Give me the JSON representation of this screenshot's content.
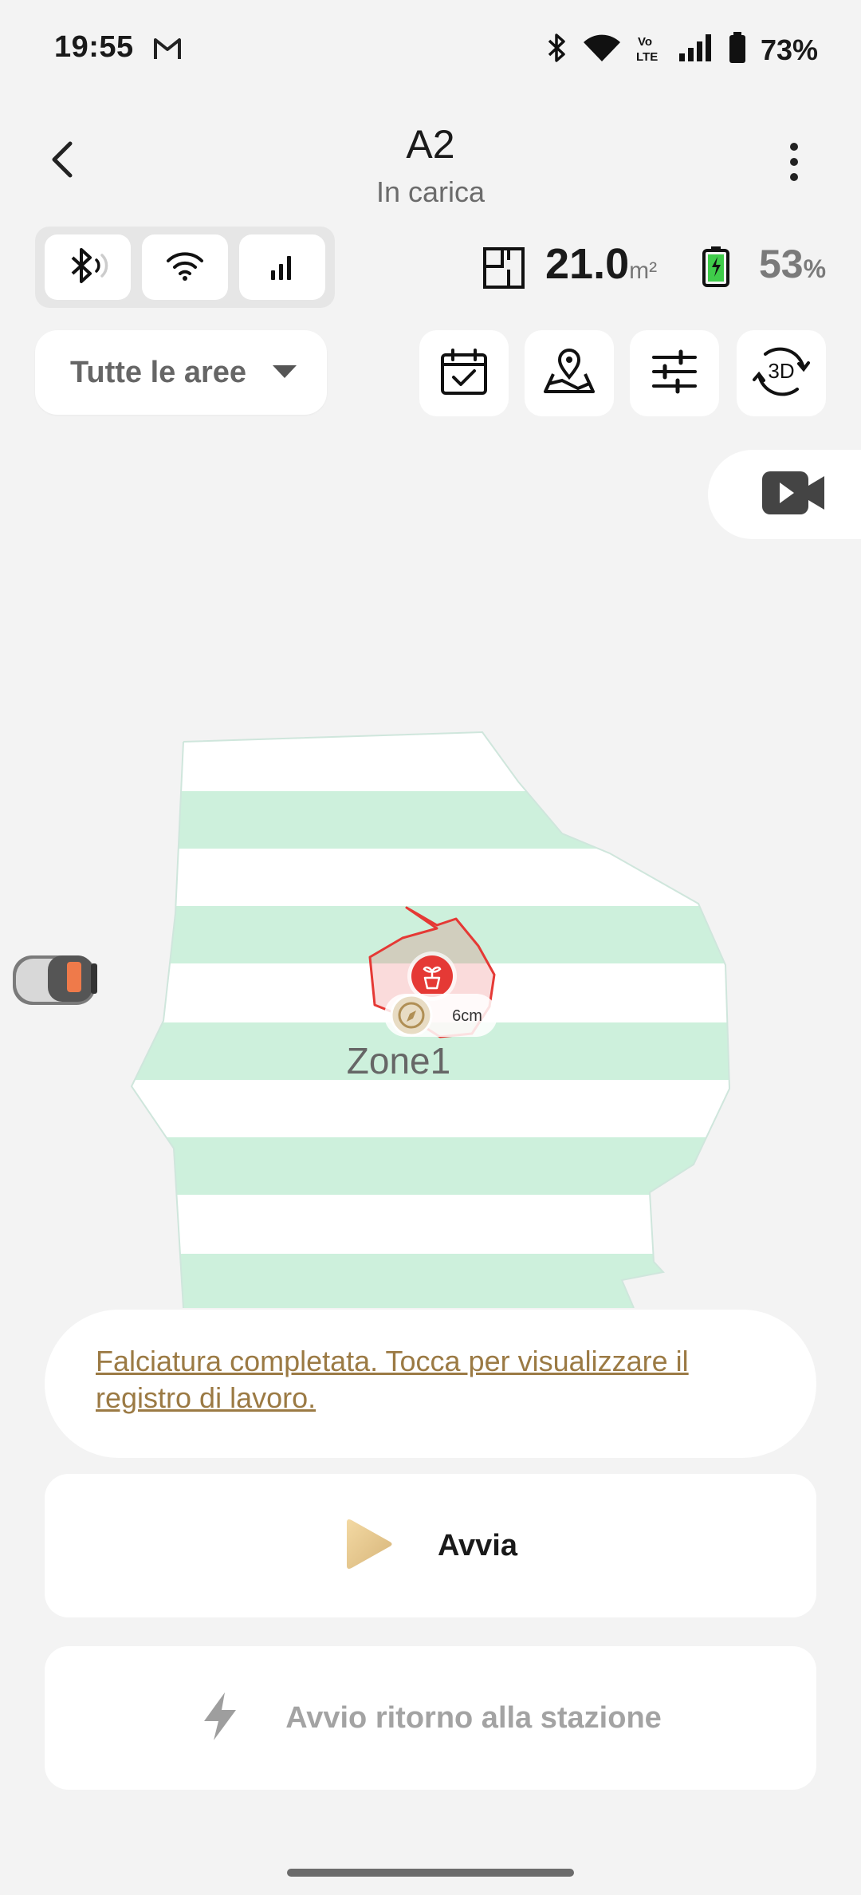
{
  "status_bar": {
    "time": "19:55",
    "battery": "73%",
    "icons": [
      "gmail-icon",
      "bluetooth-icon",
      "wifi-icon",
      "volte-icon",
      "signal-icon",
      "battery-icon"
    ]
  },
  "header": {
    "title": "A2",
    "subtitle": "In carica",
    "back_icon": "back-arrow-icon",
    "more_icon": "more-vert-icon"
  },
  "connectivity": {
    "items": [
      "bluetooth-icon",
      "wifi-icon",
      "cellular-signal-icon"
    ]
  },
  "stats": {
    "area_value": "21.0",
    "area_unit": "m²",
    "battery_value": "53",
    "battery_unit": "%"
  },
  "filter": {
    "selected": "Tutte le aree"
  },
  "tools": [
    "schedule-icon",
    "map-edit-icon",
    "settings-sliders-icon",
    "3d-view-icon",
    "camera-icon"
  ],
  "map": {
    "zone_label": "Zone1",
    "height_label": "6cm",
    "colors": {
      "stripe": "#cdf0dc",
      "obstacle": "#e53935",
      "height_badge": "#e8dcc4"
    }
  },
  "notice": {
    "text": "Falciatura completata. Tocca per visualizzare il registro di lavoro."
  },
  "actions": {
    "start_label": "Avvia",
    "dock_label": "Avvio ritorno alla stazione"
  }
}
